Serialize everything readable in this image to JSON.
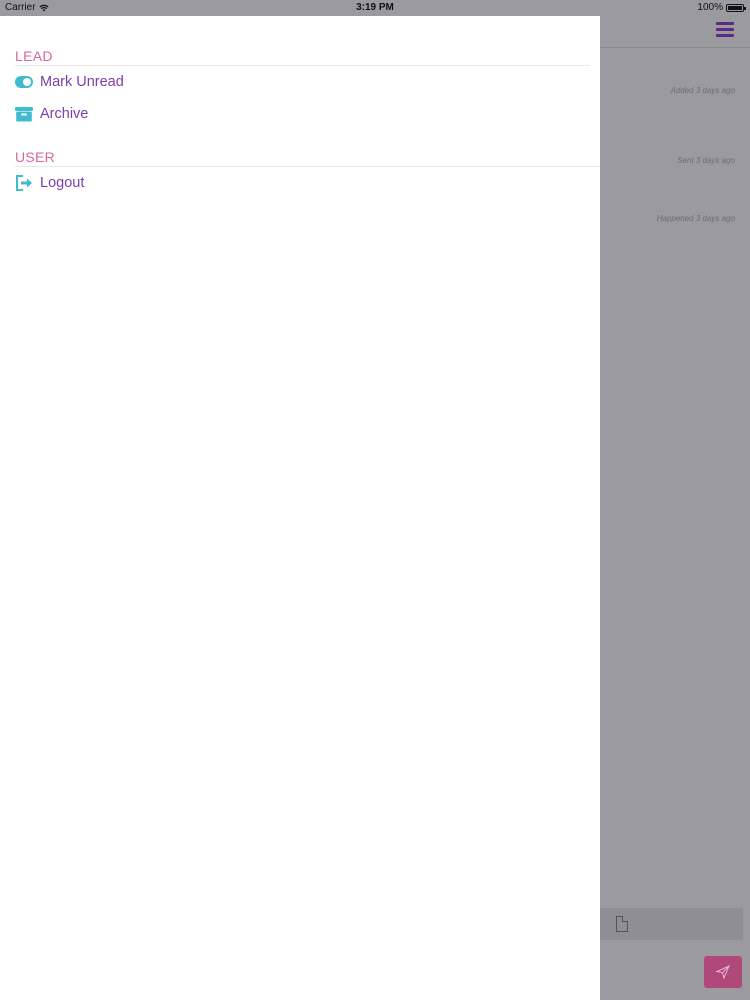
{
  "status_bar": {
    "carrier": "Carrier",
    "time": "3:19 PM",
    "battery": "100%"
  },
  "drawer": {
    "sections": [
      {
        "title": "LEAD",
        "items": [
          {
            "label": "Mark Unread",
            "icon": "toggle-icon"
          },
          {
            "label": "Archive",
            "icon": "archive-box-icon"
          }
        ]
      },
      {
        "title": "USER",
        "items": [
          {
            "label": "Logout",
            "icon": "logout-icon"
          }
        ]
      }
    ]
  },
  "background": {
    "timeline": [
      "Added 3 days ago",
      "Sent 3 days ago",
      "Happened 3 days ago"
    ]
  },
  "colors": {
    "section_header": "#d9679a",
    "menu_text": "#7b3fa8",
    "icon": "#3fbcd0",
    "send_button": "#b04879",
    "overlay": "#9b9a9e"
  }
}
